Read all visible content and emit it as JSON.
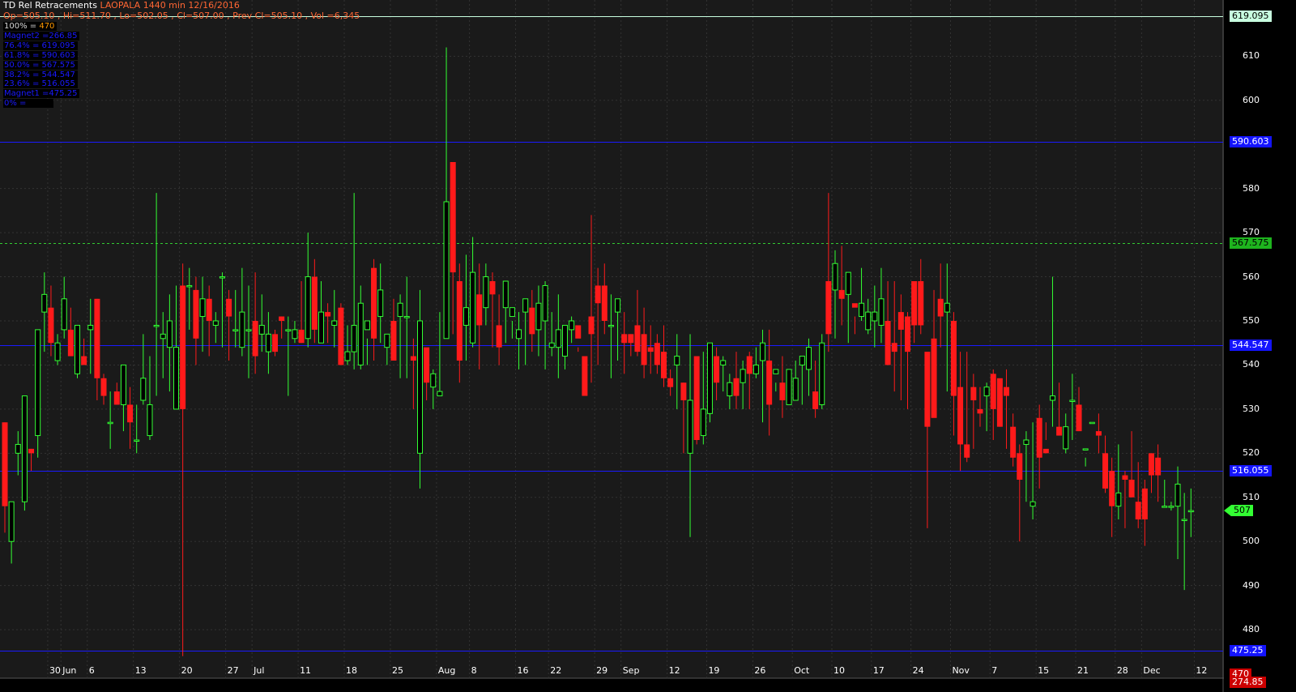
{
  "header": {
    "indicator": "TD Rel Retracements",
    "title": "LAOPALA 1440 min 12/16/2016",
    "ohlc": "Op=505.10 , Hi=511.70 , Lo=502.05 , Cl=507.00 , Prev Cl=505.10 , Vol =6,345"
  },
  "retracement_legend": [
    {
      "label": "100% = ",
      "value": "470"
    },
    {
      "label": "Magnet2 =266.85",
      "value": ""
    },
    {
      "label": "76.4% = 619.095",
      "value": ""
    },
    {
      "label": "61.8% = 590.603",
      "value": ""
    },
    {
      "label": "50.0% = 567.575",
      "value": ""
    },
    {
      "label": "38.2% = 544.547",
      "value": ""
    },
    {
      "label": "23.6% = 516.055",
      "value": ""
    },
    {
      "label": "Magnet1 =475.25",
      "value": ""
    },
    {
      "label": "0% = ",
      "value": ""
    }
  ],
  "price_tags": [
    {
      "text": "619.095",
      "price": 619.095,
      "bg": "#c8ffe0",
      "fg": "#000000",
      "line": "#c8ffe0",
      "style": "solid"
    },
    {
      "text": "590.603",
      "price": 590.603,
      "bg": "#1414ff",
      "fg": "#ffffff",
      "line": "#1a1aff",
      "style": "solid"
    },
    {
      "text": "567.575",
      "price": 567.575,
      "bg": "#1eb41e",
      "fg": "#000000",
      "line": "#33cc33",
      "style": "dashed"
    },
    {
      "text": "544.547",
      "price": 544.547,
      "bg": "#1414ff",
      "fg": "#ffffff",
      "line": "#1a1aff",
      "style": "solid"
    },
    {
      "text": "516.055",
      "price": 516.055,
      "bg": "#1414ff",
      "fg": "#ffffff",
      "line": "#1a1aff",
      "style": "solid"
    },
    {
      "text": "475.25",
      "price": 475.25,
      "bg": "#1414ff",
      "fg": "#ffffff",
      "line": "#1a1aff",
      "style": "solid"
    },
    {
      "text": "507",
      "price": 507,
      "bg": "#33ff33",
      "fg": "#000000",
      "line": "",
      "style": "arrow"
    },
    {
      "text": "470",
      "price": 470,
      "bg": "#cc0000",
      "fg": "#ffffff",
      "line": "",
      "style": "none"
    },
    {
      "text": "274.85",
      "price": 468.9,
      "bg": "#cc0000",
      "fg": "#ffffff",
      "line": "",
      "style": "none"
    }
  ],
  "colors": {
    "up": "#33ff33",
    "down": "#ff1a1a",
    "grid": "#2a2a2a",
    "background": "#1a1a1a"
  },
  "chart_data": {
    "type": "candlestick",
    "ylim": [
      469,
      622
    ],
    "y_ticks": [
      480,
      490,
      500,
      510,
      520,
      530,
      540,
      550,
      560,
      570,
      580,
      600,
      610
    ],
    "x_ticks": [
      "30",
      "Jun",
      "6",
      "13",
      "20",
      "27",
      "Jul",
      "11",
      "18",
      "25",
      "Aug",
      "8",
      "16",
      "22",
      "29",
      "Sep",
      "12",
      "19",
      "26",
      "Oct",
      "10",
      "17",
      "24",
      "Nov",
      "7",
      "15",
      "21",
      "28",
      "Dec",
      "12"
    ],
    "retracement_levels": {
      "100%": 470,
      "Magnet2": 266.85,
      "76.4%": 619.095,
      "61.8%": 590.603,
      "50.0%": 567.575,
      "38.2%": 544.547,
      "23.6%": 516.055,
      "Magnet1": 475.25
    },
    "last": {
      "open": 505.1,
      "high": 511.7,
      "low": 502.05,
      "close": 507.0,
      "prev_close": 505.1,
      "volume": 6345
    },
    "ohlc": [
      [
        527,
        527,
        502,
        508
      ],
      [
        500,
        509,
        495,
        509
      ],
      [
        520,
        525,
        515,
        522
      ],
      [
        509,
        533,
        507,
        533
      ],
      [
        521,
        521,
        516,
        520
      ],
      [
        524,
        548,
        519,
        548
      ],
      [
        552,
        561,
        543,
        556
      ],
      [
        553,
        558,
        542,
        545
      ],
      [
        541,
        547,
        540,
        545
      ],
      [
        548,
        560,
        546,
        555
      ],
      [
        548,
        553,
        542,
        542
      ],
      [
        538,
        549,
        537,
        549
      ],
      [
        542,
        546,
        540,
        540
      ],
      [
        548,
        555,
        538,
        549
      ],
      [
        555,
        555,
        532,
        537
      ],
      [
        537,
        538,
        531,
        533
      ],
      [
        527,
        534,
        521,
        527
      ],
      [
        534,
        536,
        531,
        531
      ],
      [
        531,
        540,
        525,
        540
      ],
      [
        531,
        535,
        521,
        527
      ],
      [
        523,
        531,
        520,
        523
      ],
      [
        532,
        547,
        531,
        537
      ],
      [
        524,
        542,
        523,
        531
      ],
      [
        549,
        579,
        533,
        549
      ],
      [
        546,
        552,
        537,
        547
      ],
      [
        544,
        556,
        534,
        550
      ],
      [
        530,
        558,
        530,
        544
      ],
      [
        558,
        563,
        474,
        530
      ],
      [
        558,
        562,
        548,
        558
      ],
      [
        557,
        560,
        540,
        546
      ],
      [
        551,
        560,
        543,
        555
      ],
      [
        555,
        558,
        542,
        550
      ],
      [
        549,
        552,
        545,
        550
      ],
      [
        560,
        561,
        544,
        560
      ],
      [
        555,
        557,
        541,
        551
      ],
      [
        548,
        557,
        544,
        548
      ],
      [
        544,
        562,
        542,
        552
      ],
      [
        548,
        558,
        537,
        548
      ],
      [
        550,
        561,
        538,
        542
      ],
      [
        547,
        556,
        543,
        549
      ],
      [
        543,
        552,
        538,
        547
      ],
      [
        547,
        548,
        542,
        543
      ],
      [
        551,
        551,
        546,
        550
      ],
      [
        548,
        551,
        533,
        548
      ],
      [
        546,
        550,
        545,
        548
      ],
      [
        548,
        559,
        545,
        545
      ],
      [
        546,
        570,
        544,
        560
      ],
      [
        560,
        564,
        545,
        548
      ],
      [
        545,
        559,
        546,
        552
      ],
      [
        552,
        554,
        545,
        551
      ],
      [
        549,
        557,
        544,
        550
      ],
      [
        553,
        554,
        540,
        540
      ],
      [
        541,
        549,
        540,
        543
      ],
      [
        543,
        579,
        539,
        549
      ],
      [
        540,
        558,
        539,
        554
      ],
      [
        548,
        546,
        540,
        550
      ],
      [
        562,
        564,
        541,
        546
      ],
      [
        551,
        563,
        545,
        557
      ],
      [
        544,
        545,
        540,
        547
      ],
      [
        550,
        555,
        542,
        541
      ],
      [
        551,
        556,
        537,
        554
      ],
      [
        551,
        560,
        537,
        551
      ],
      [
        542,
        546,
        530,
        541
      ],
      [
        520,
        557,
        512,
        550
      ],
      [
        544,
        539,
        532,
        536
      ],
      [
        535,
        539,
        530,
        538
      ],
      [
        533,
        552,
        533,
        534
      ],
      [
        546,
        612,
        546,
        577
      ],
      [
        586,
        586,
        547,
        561
      ],
      [
        559,
        563,
        536,
        541
      ],
      [
        549,
        565,
        541,
        553
      ],
      [
        545,
        569,
        544,
        561
      ],
      [
        556,
        563,
        539,
        549
      ],
      [
        553,
        563,
        549,
        560
      ],
      [
        559,
        561,
        544,
        556
      ],
      [
        549,
        556,
        540,
        544
      ],
      [
        553,
        553,
        545,
        559
      ],
      [
        551,
        550,
        546,
        553
      ],
      [
        546,
        552,
        539,
        548
      ],
      [
        552,
        554,
        540,
        555
      ],
      [
        553,
        557,
        543,
        547
      ],
      [
        548,
        558,
        542,
        554
      ],
      [
        550,
        559,
        539,
        558
      ],
      [
        544,
        552,
        542,
        545
      ],
      [
        544,
        556,
        537,
        548
      ],
      [
        542,
        547,
        539,
        549
      ],
      [
        548,
        551,
        545,
        550
      ],
      [
        549,
        544,
        543,
        546
      ],
      [
        542,
        538,
        536,
        533
      ],
      [
        551,
        574,
        536,
        547
      ],
      [
        558,
        562,
        540,
        554
      ],
      [
        558,
        563,
        547,
        550
      ],
      [
        549,
        556,
        537,
        549
      ],
      [
        552,
        554,
        541,
        555
      ],
      [
        547,
        552,
        538,
        545
      ],
      [
        547,
        547,
        542,
        545
      ],
      [
        549,
        557,
        542,
        543
      ],
      [
        547,
        553,
        537,
        540
      ],
      [
        544,
        549,
        538,
        543
      ],
      [
        545,
        547,
        538,
        540
      ],
      [
        543,
        549,
        535,
        537
      ],
      [
        537,
        539,
        533,
        535
      ],
      [
        540,
        547,
        530,
        542
      ],
      [
        536,
        536,
        520,
        532
      ],
      [
        520,
        547,
        501,
        532
      ],
      [
        542,
        526,
        522,
        523
      ],
      [
        524,
        543,
        522,
        530
      ],
      [
        529,
        545,
        527,
        545
      ],
      [
        542,
        544,
        532,
        536
      ],
      [
        540,
        542,
        534,
        541
      ],
      [
        533,
        538,
        530,
        536
      ],
      [
        537,
        543,
        530,
        533
      ],
      [
        536,
        541,
        530,
        539
      ],
      [
        542,
        543,
        530,
        538
      ],
      [
        538,
        544,
        537,
        540
      ],
      [
        541,
        548,
        527,
        545
      ],
      [
        541,
        548,
        524,
        531
      ],
      [
        538,
        536,
        534,
        539
      ],
      [
        536,
        542,
        528,
        532
      ],
      [
        531,
        538,
        531,
        539
      ],
      [
        532,
        541,
        534,
        537
      ],
      [
        540,
        541,
        531,
        542
      ],
      [
        539,
        546,
        533,
        544
      ],
      [
        534,
        541,
        528,
        530
      ],
      [
        531,
        547,
        530,
        545
      ],
      [
        559,
        579,
        543,
        547
      ],
      [
        557,
        566,
        546,
        563
      ],
      [
        557,
        567,
        549,
        555
      ],
      [
        556,
        557,
        545,
        561
      ],
      [
        554,
        551,
        547,
        553
      ],
      [
        551,
        562,
        550,
        554
      ],
      [
        548,
        555,
        547,
        552
      ],
      [
        550,
        558,
        544,
        552
      ],
      [
        549,
        562,
        545,
        555
      ],
      [
        550,
        559,
        541,
        540
      ],
      [
        545,
        559,
        534,
        543
      ],
      [
        552,
        556,
        532,
        548
      ],
      [
        551,
        552,
        530,
        543
      ],
      [
        559,
        559,
        545,
        549
      ],
      [
        559,
        564,
        547,
        549
      ],
      [
        543,
        542,
        503,
        526
      ],
      [
        546,
        557,
        532,
        528
      ],
      [
        555,
        563,
        544,
        551
      ],
      [
        552,
        563,
        534,
        554
      ],
      [
        550,
        552,
        524,
        533
      ],
      [
        535,
        543,
        516,
        522
      ],
      [
        522,
        543,
        518,
        519
      ],
      [
        535,
        538,
        521,
        532
      ],
      [
        530,
        535,
        526,
        529
      ],
      [
        533,
        536,
        525,
        535
      ],
      [
        538,
        539,
        523,
        530
      ],
      [
        537,
        536,
        526,
        526
      ],
      [
        535,
        539,
        521,
        533
      ],
      [
        526,
        529,
        517,
        519
      ],
      [
        520,
        522,
        500,
        514
      ],
      [
        522,
        525,
        509,
        523
      ],
      [
        508,
        527,
        505,
        509
      ],
      [
        528,
        531,
        512,
        519
      ],
      [
        521,
        527,
        523,
        520
      ],
      [
        532,
        560,
        526,
        533
      ],
      [
        526,
        536,
        524,
        524
      ],
      [
        521,
        529,
        520,
        526
      ],
      [
        532,
        538,
        523,
        532
      ],
      [
        531,
        535,
        525,
        525
      ],
      [
        521,
        519,
        517,
        521
      ],
      [
        527,
        527,
        527,
        527
      ],
      [
        525,
        529,
        520,
        524
      ],
      [
        520,
        524,
        511,
        512
      ],
      [
        516,
        519,
        501,
        508
      ],
      [
        508,
        522,
        505,
        511
      ],
      [
        515,
        516,
        503,
        514
      ],
      [
        514,
        525,
        510,
        510
      ],
      [
        509,
        518,
        503,
        505
      ],
      [
        512,
        514,
        499,
        505
      ],
      [
        520,
        518,
        511,
        515
      ],
      [
        519,
        522,
        509,
        515
      ],
      [
        508,
        514,
        508,
        508
      ],
      [
        508,
        509,
        507,
        508
      ],
      [
        508,
        517,
        496,
        513
      ],
      [
        505,
        511,
        489,
        505
      ],
      [
        507,
        512,
        501,
        507
      ]
    ]
  }
}
